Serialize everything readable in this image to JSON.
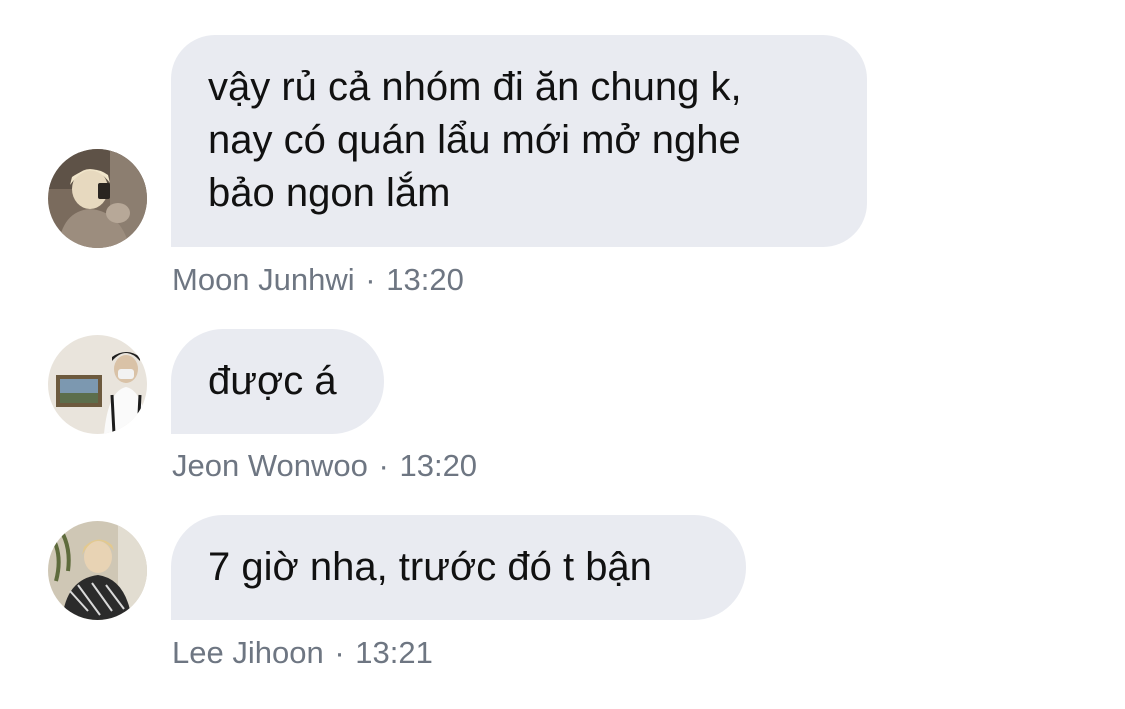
{
  "messages": [
    {
      "lines": [
        "vậy rủ cả nhóm đi ăn chung k,",
        "nay có quán lẩu mới mở nghe",
        "bảo ngon lắm"
      ],
      "sender": "Moon Junhwi",
      "separator": "·",
      "time": "13:20",
      "avatar": "avatar-photo"
    },
    {
      "lines": [
        "được á"
      ],
      "sender": "Jeon Wonwoo",
      "separator": "·",
      "time": "13:20",
      "avatar": "avatar-photo"
    },
    {
      "lines": [
        "7 giờ nha, trước đó t bận"
      ],
      "sender": "Lee Jihoon",
      "separator": "·",
      "time": "13:21",
      "avatar": "avatar-photo"
    }
  ],
  "colors": {
    "bubble": "#e9ebf1",
    "text": "#111111",
    "meta": "#6e7682",
    "background": "#ffffff"
  }
}
